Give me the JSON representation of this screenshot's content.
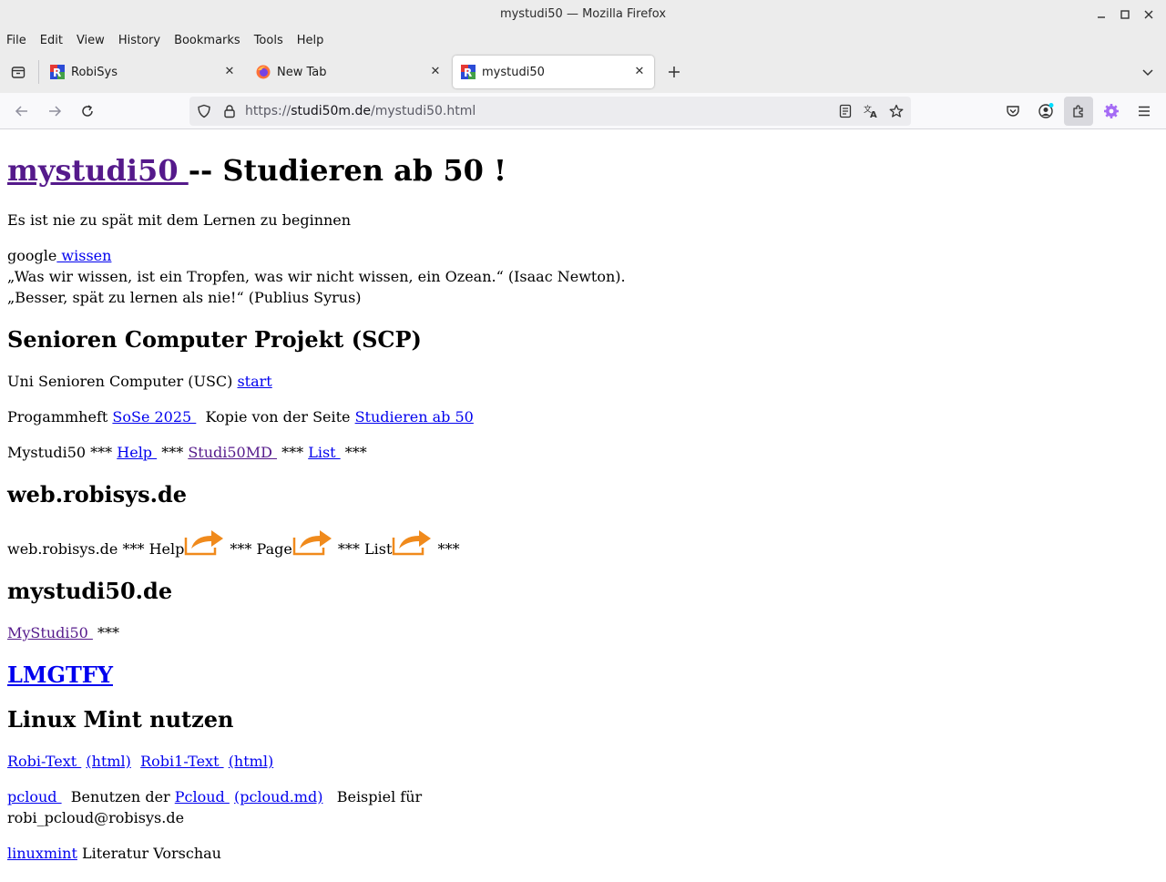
{
  "window": {
    "title": "mystudi50 — Mozilla Firefox"
  },
  "menu": [
    "File",
    "Edit",
    "View",
    "History",
    "Bookmarks",
    "Tools",
    "Help"
  ],
  "tabs": [
    {
      "label": "RobiSys"
    },
    {
      "label": "New Tab"
    },
    {
      "label": "mystudi50"
    }
  ],
  "url": {
    "scheme": "https://",
    "host": "studi50m.de",
    "path": "/mystudi50.html"
  },
  "page": {
    "h1_link": "mystudi50 ",
    "h1_rest": " -- Studieren ab 50 !",
    "intro": "Es ist nie zu spät mit dem Lernen zu beginnen",
    "google_text": "google",
    "google_link": " wissen",
    "quote1": "„Was wir wissen, ist ein Tropfen, was wir nicht wissen, ein Ozean.“ (Isaac Newton).",
    "quote2": "„Besser, spät zu lernen als nie!“ (Publius Syrus)",
    "scp": {
      "heading": "Senioren Computer Projekt (SCP)",
      "usc_text": "Uni Senioren Computer (USC) ",
      "usc_link": "start",
      "prog_text": "Progammheft ",
      "prog_link": "SoSe 2025 ",
      "prog_mid": "  Kopie von der Seite ",
      "prog_link2": "Studieren ab 50",
      "my_text": "Mystudi50 *** ",
      "my_help": "Help ",
      "my_sep1": " *** ",
      "my_md": "Studi50MD ",
      "my_sep2": " *** ",
      "my_list": "List ",
      "my_sep3": " ***"
    },
    "web": {
      "heading": "web.robisys.de",
      "line_start": "web.robisys.de *** Help",
      "sep_page": " *** Page",
      "sep_list": " *** List",
      "line_end": " ***"
    },
    "my50": {
      "heading": "mystudi50.de",
      "link": "MyStudi50 ",
      "after": " ***"
    },
    "lmgtfy": "LMGTFY",
    "mint": {
      "heading": "Linux Mint nutzen",
      "robi_text": "Robi-Text ",
      "robi_html": "(html)",
      "robi1_text": "Robi1-Text ",
      "robi1_html": "(html)",
      "pcloud_link": "pcloud ",
      "pcloud_mid": "  Benutzen der ",
      "pcloud_link2": "Pcloud ",
      "pcloud_md": "(pcloud.md)",
      "pcloud_end": "   Beispiel für",
      "pcloud_mail": "robi_pcloud@robisys.de",
      "linuxmint_link": "linuxmint",
      "linuxmint_text": " Literatur Vorschau"
    }
  },
  "colors": {
    "link": "#0000ee",
    "visited": "#551a8b",
    "arrow": "#f08a1c"
  }
}
